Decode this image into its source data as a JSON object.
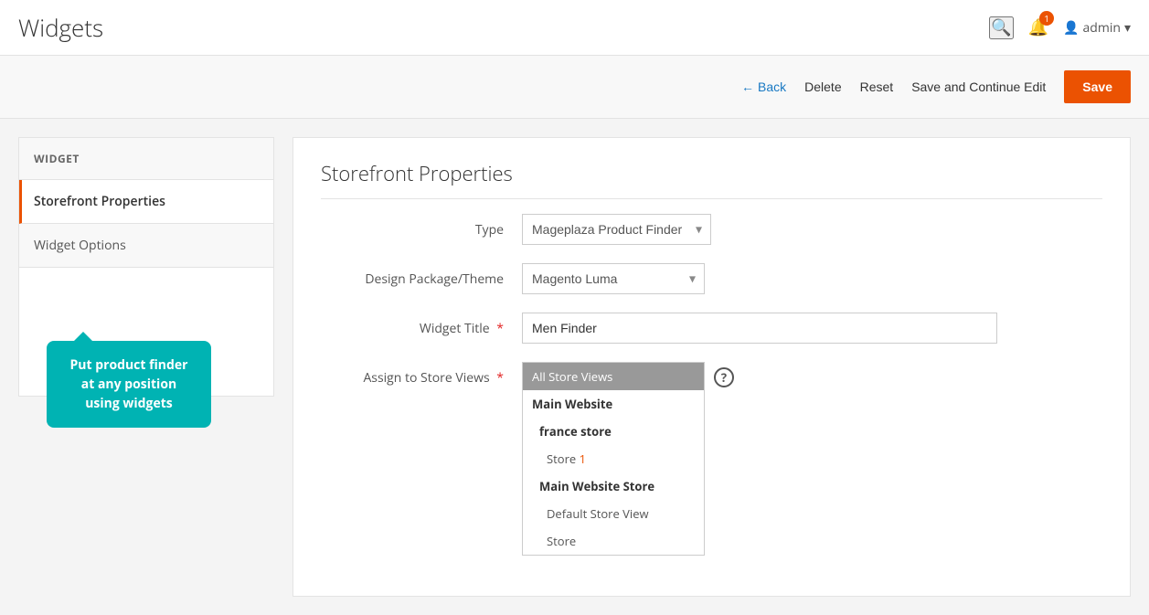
{
  "page": {
    "title": "Widgets"
  },
  "header": {
    "search_icon": "🔍",
    "notification_count": "1",
    "admin_label": "admin",
    "chevron_icon": "▾",
    "user_icon": "👤"
  },
  "toolbar": {
    "back_label": "Back",
    "delete_label": "Delete",
    "reset_label": "Reset",
    "save_continue_label": "Save and Continue Edit",
    "save_label": "Save"
  },
  "sidebar": {
    "widget_label": "WIDGET",
    "items": [
      {
        "label": "Storefront Properties",
        "active": true
      },
      {
        "label": "Widget Options",
        "active": false
      }
    ]
  },
  "tooltip": {
    "text": "Put product finder at any position using widgets"
  },
  "form": {
    "section_title": "Storefront Properties",
    "fields": {
      "type": {
        "label": "Type",
        "value": "Mageplaza Product Finder",
        "options": [
          "Mageplaza Product Finder"
        ]
      },
      "design_package": {
        "label": "Design Package/Theme",
        "value": "Magento Luma",
        "options": [
          "Magento Luma"
        ]
      },
      "widget_title": {
        "label": "Widget Title",
        "required": true,
        "value": "Men Finder",
        "placeholder": ""
      },
      "store_views": {
        "label": "Assign to Store Views",
        "required": true,
        "items": [
          {
            "label": "All Store Views",
            "selected": true,
            "type": "item"
          },
          {
            "label": "Main Website",
            "selected": false,
            "type": "group"
          },
          {
            "label": "france store",
            "selected": false,
            "type": "subgroup"
          },
          {
            "label": "Store",
            "number": "1",
            "selected": false,
            "type": "indent2"
          },
          {
            "label": "Main Website Store",
            "selected": false,
            "type": "subgroup"
          },
          {
            "label": "Default Store View",
            "selected": false,
            "type": "indent2"
          },
          {
            "label": "Store",
            "number": "",
            "selected": false,
            "type": "indent2"
          }
        ]
      }
    }
  }
}
